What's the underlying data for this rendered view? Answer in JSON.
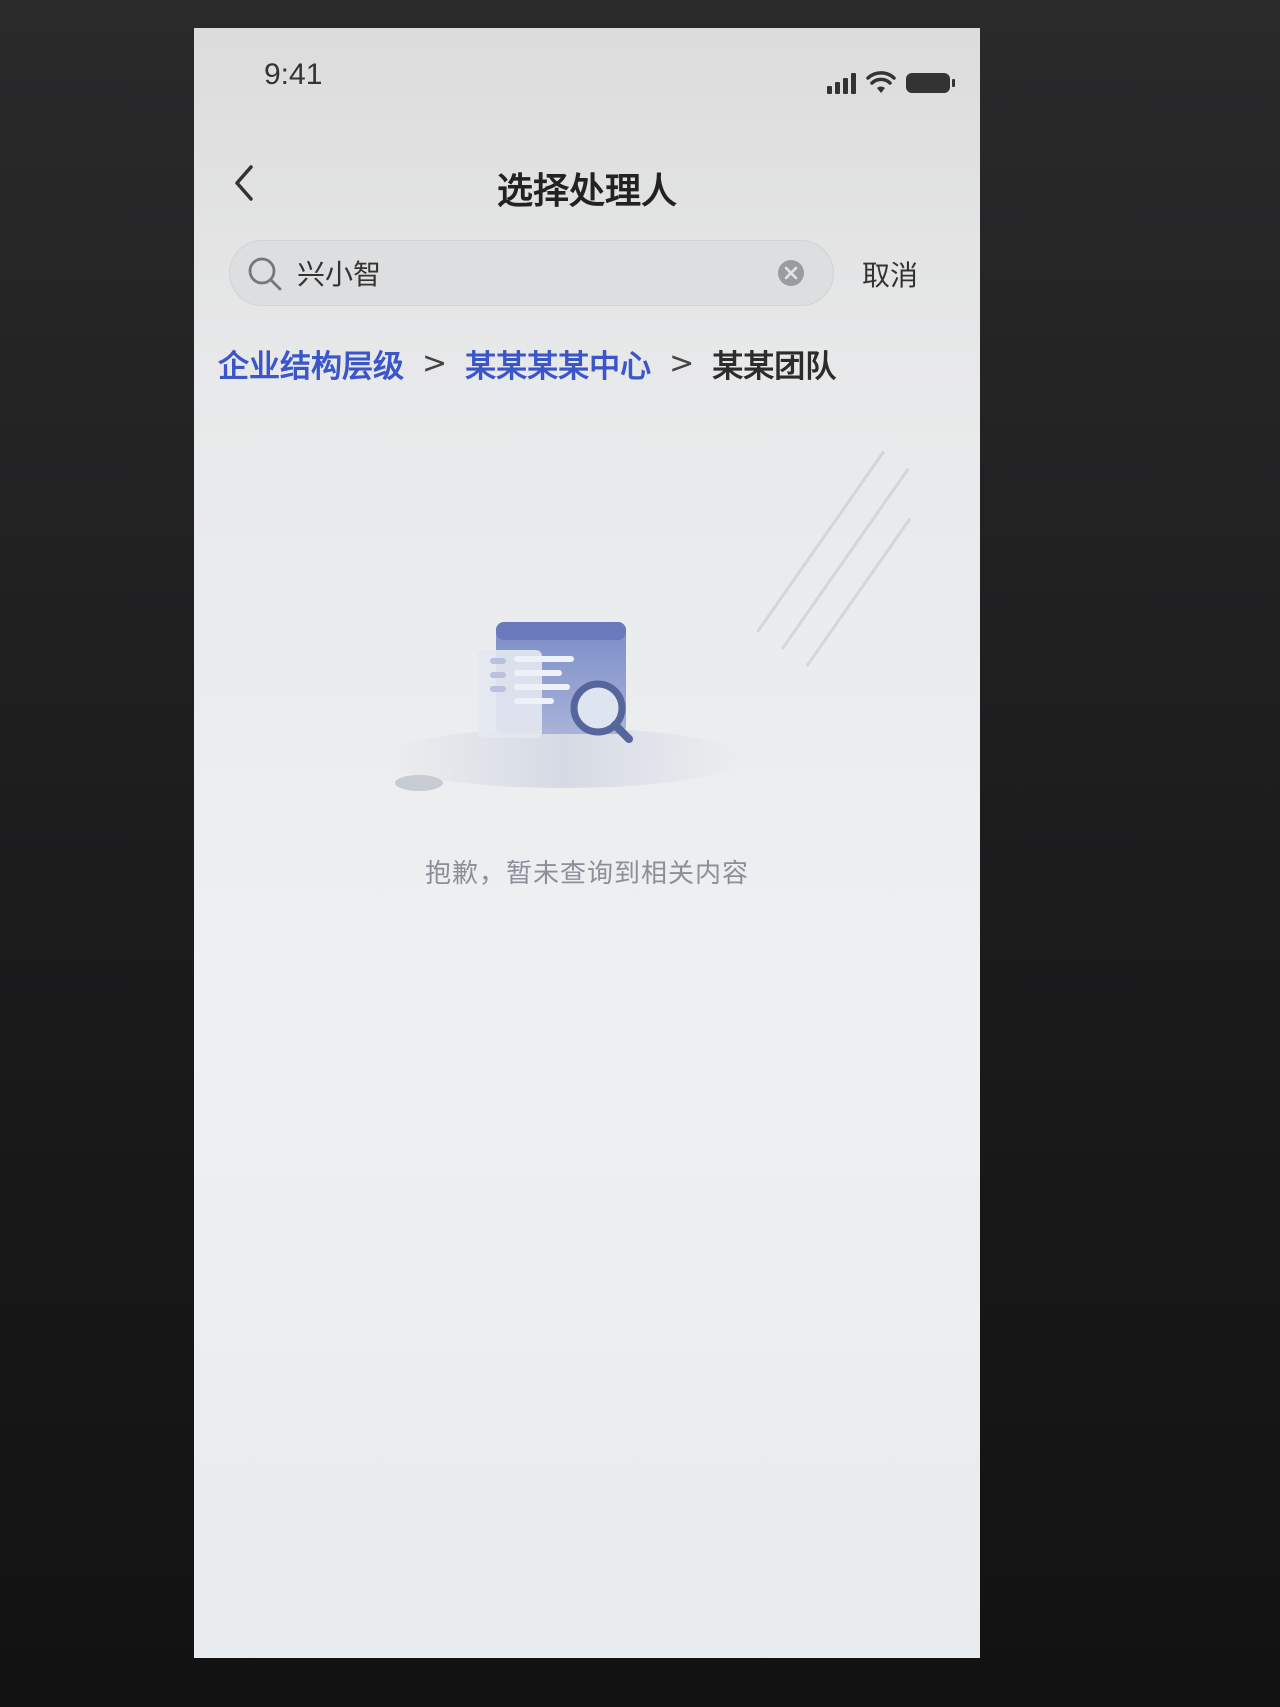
{
  "status_bar": {
    "time": "9:41"
  },
  "nav": {
    "title": "选择处理人",
    "back_icon": "chevron-left-icon"
  },
  "search": {
    "value": "兴小智",
    "placeholder": "",
    "cancel_label": "取消",
    "search_icon": "search-icon",
    "clear_icon": "clear-icon"
  },
  "breadcrumb": {
    "items": [
      {
        "label": "企业结构层级",
        "link": true
      },
      {
        "label": "某某某某中心",
        "link": true
      },
      {
        "label": "某某团队",
        "link": false
      }
    ],
    "separator": ">"
  },
  "empty_state": {
    "message": "抱歉，暂未查询到相关内容",
    "icon": "empty-search-illustration"
  },
  "colors": {
    "link": "#3b56c8",
    "title": "#222222",
    "muted": "#8a8f99",
    "illustration": "#6f7fb2"
  }
}
